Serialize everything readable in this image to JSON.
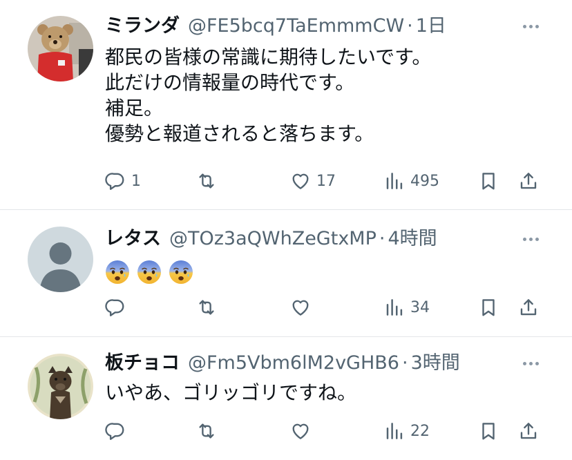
{
  "tweets": [
    {
      "name": "ミランダ",
      "handle": "@FE5bcq7TaEmmmCW",
      "separator": "·",
      "time": "1日",
      "lines": [
        "都民の皆様の常識に期待したいです。",
        "此だけの情報量の時代です。",
        "補足。",
        "優勢と報道されると落ちます。"
      ],
      "replies": "1",
      "retweets": "",
      "likes": "17",
      "views": "495",
      "avatar_icon": "teddy-bear-avatar"
    },
    {
      "name": "レタス",
      "handle": "@TOz3aQWhZeGtxMP",
      "separator": "·",
      "time": "4時間",
      "emojis": [
        "anxious-face-emoji",
        "anxious-face-emoji",
        "anxious-face-emoji"
      ],
      "replies": "",
      "retweets": "",
      "likes": "",
      "views": "34",
      "avatar_icon": "default-person-avatar"
    },
    {
      "name": "板チョコ",
      "handle": "@Fm5Vbm6lM2vGHB6",
      "separator": "·",
      "time": "3時間",
      "lines": [
        "いやあ、ゴリッゴリですね。"
      ],
      "replies": "",
      "retweets": "",
      "likes": "",
      "views": "22",
      "avatar_icon": "dog-avatar"
    }
  ],
  "colors": {
    "text": "#0f1419",
    "muted": "#536471",
    "divider": "#e3e5e8"
  }
}
